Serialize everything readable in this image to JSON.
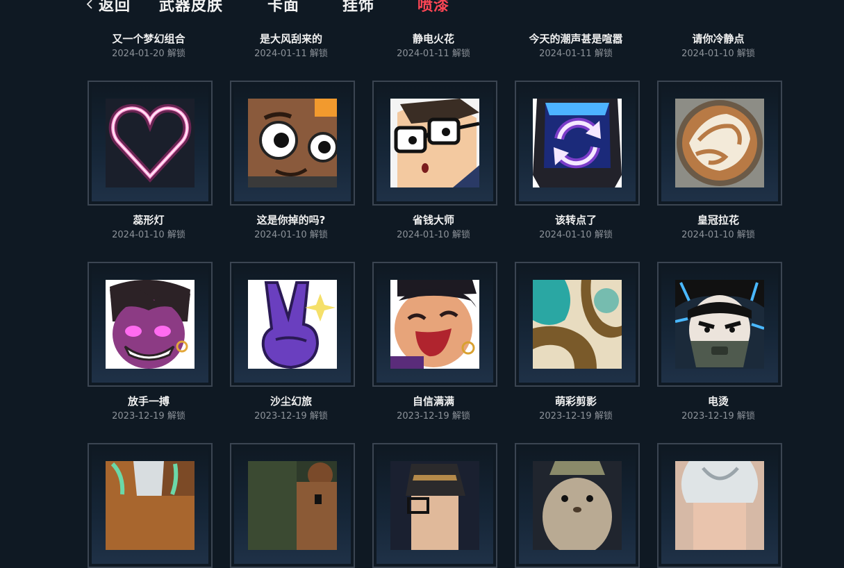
{
  "nav": {
    "back_label": "返回",
    "tabs": [
      {
        "label": "武器皮肤",
        "active": false
      },
      {
        "label": "卡面",
        "active": false
      },
      {
        "label": "挂饰",
        "active": false
      },
      {
        "label": "喷漆",
        "active": true
      }
    ]
  },
  "colors": {
    "background": "#0f1923",
    "accent": "#ff4655",
    "tile_border": "#3b4552"
  },
  "unlock_suffix": "解锁",
  "sprays": [
    {
      "name": "又一个梦幻组合",
      "date": "2024-01-20",
      "art": "none"
    },
    {
      "name": "是大风刮来的",
      "date": "2024-01-11",
      "art": "none"
    },
    {
      "name": "静电火花",
      "date": "2024-01-11",
      "art": "none"
    },
    {
      "name": "今天的潮声甚是喧嚣",
      "date": "2024-01-11",
      "art": "none"
    },
    {
      "name": "请你冷静点",
      "date": "2024-01-10",
      "art": "none"
    },
    {
      "name": "蕊形灯",
      "date": "2024-01-10",
      "art": "neon-heart"
    },
    {
      "name": "这是你掉的吗?",
      "date": "2024-01-10",
      "art": "brown-face"
    },
    {
      "name": "省钱大师",
      "date": "2024-01-10",
      "art": "glasses-face"
    },
    {
      "name": "该转点了",
      "date": "2024-01-10",
      "art": "rotate-arrows"
    },
    {
      "name": "皇冠拉花",
      "date": "2024-01-10",
      "art": "latte-art"
    },
    {
      "name": "放手一搏",
      "date": "2023-12-19",
      "art": "purple-grin"
    },
    {
      "name": "沙尘幻旅",
      "date": "2023-12-19",
      "art": "peace-hand"
    },
    {
      "name": "自信满满",
      "date": "2023-12-19",
      "art": "laughing-face"
    },
    {
      "name": "萌彩剪影",
      "date": "2023-12-19",
      "art": "teal-pattern"
    },
    {
      "name": "电烫",
      "date": "2023-12-19",
      "art": "masked-face"
    },
    {
      "name": "",
      "date": "",
      "art": "fox-ears"
    },
    {
      "name": "",
      "date": "",
      "art": "bear-green"
    },
    {
      "name": "",
      "date": "",
      "art": "dark-hair-glasses"
    },
    {
      "name": "",
      "date": "",
      "art": "seal-helmet"
    },
    {
      "name": "",
      "date": "",
      "art": "silver-hair"
    }
  ]
}
